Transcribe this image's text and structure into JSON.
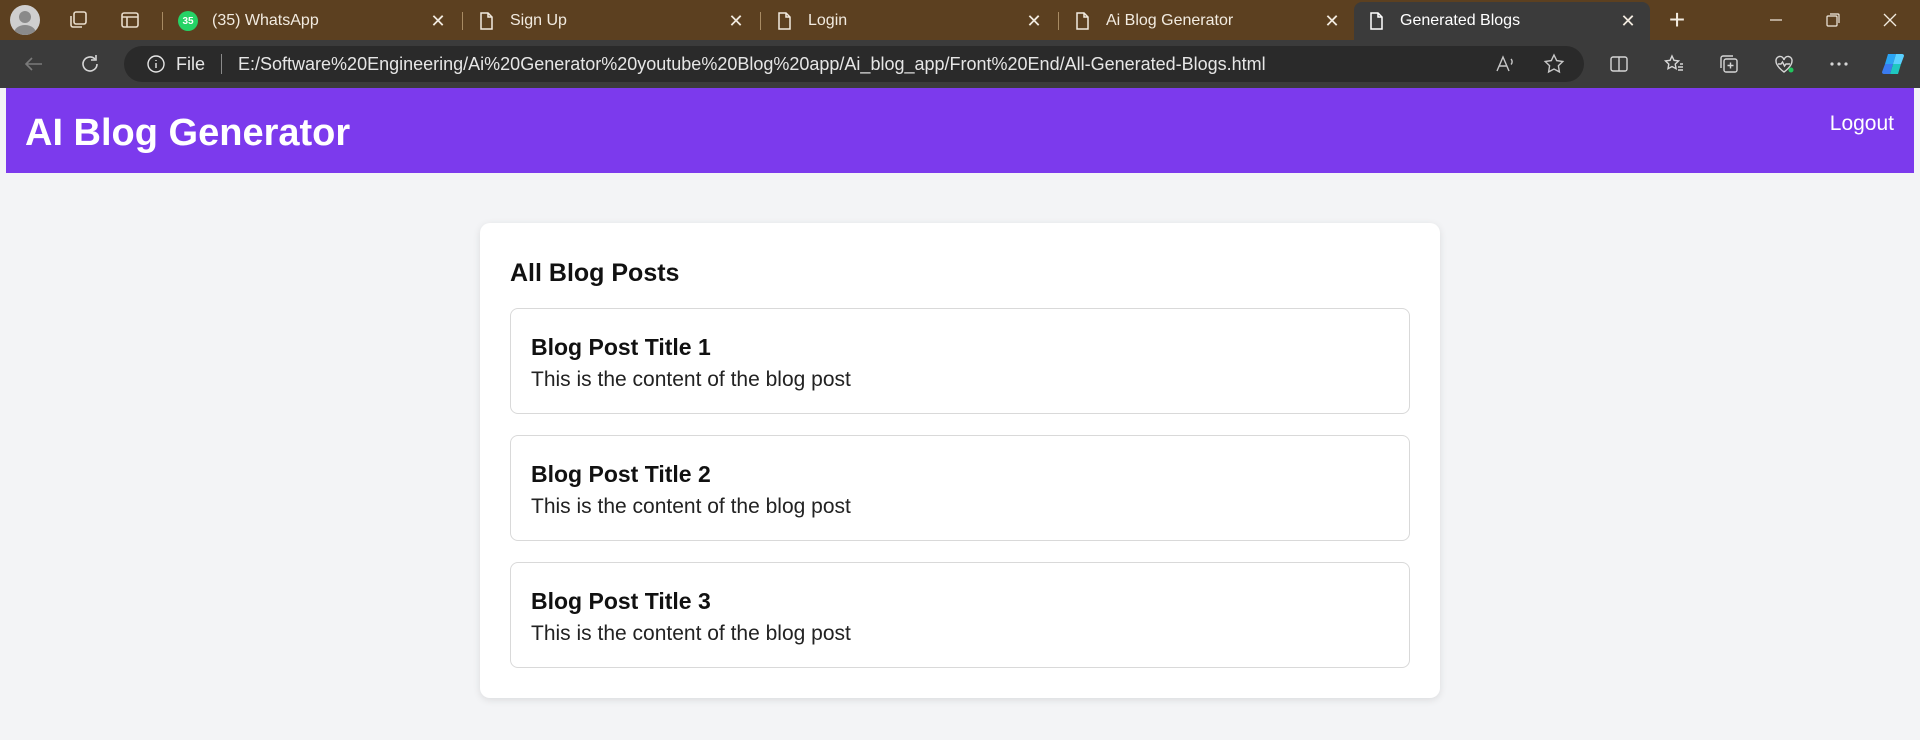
{
  "browser": {
    "tabs": [
      {
        "title": "(35) WhatsApp",
        "badge": "35"
      },
      {
        "title": "Sign Up"
      },
      {
        "title": "Login"
      },
      {
        "title": "Ai Blog Generator"
      },
      {
        "title": "Generated Blogs"
      }
    ],
    "address": {
      "scheme_label": "File",
      "url": "E:/Software%20Engineering/Ai%20Generator%20youtube%20Blog%20app/Ai_blog_app/Front%20End/All-Generated-Blogs.html"
    }
  },
  "app": {
    "title": "AI Blog Generator",
    "logout_label": "Logout",
    "accent_color": "#7c3aed"
  },
  "main": {
    "heading": "All Blog Posts",
    "posts": [
      {
        "title": "Blog Post Title 1",
        "content": "This is the content of the blog post"
      },
      {
        "title": "Blog Post Title 2",
        "content": "This is the content of the blog post"
      },
      {
        "title": "Blog Post Title 3",
        "content": "This is the content of the blog post"
      }
    ]
  }
}
